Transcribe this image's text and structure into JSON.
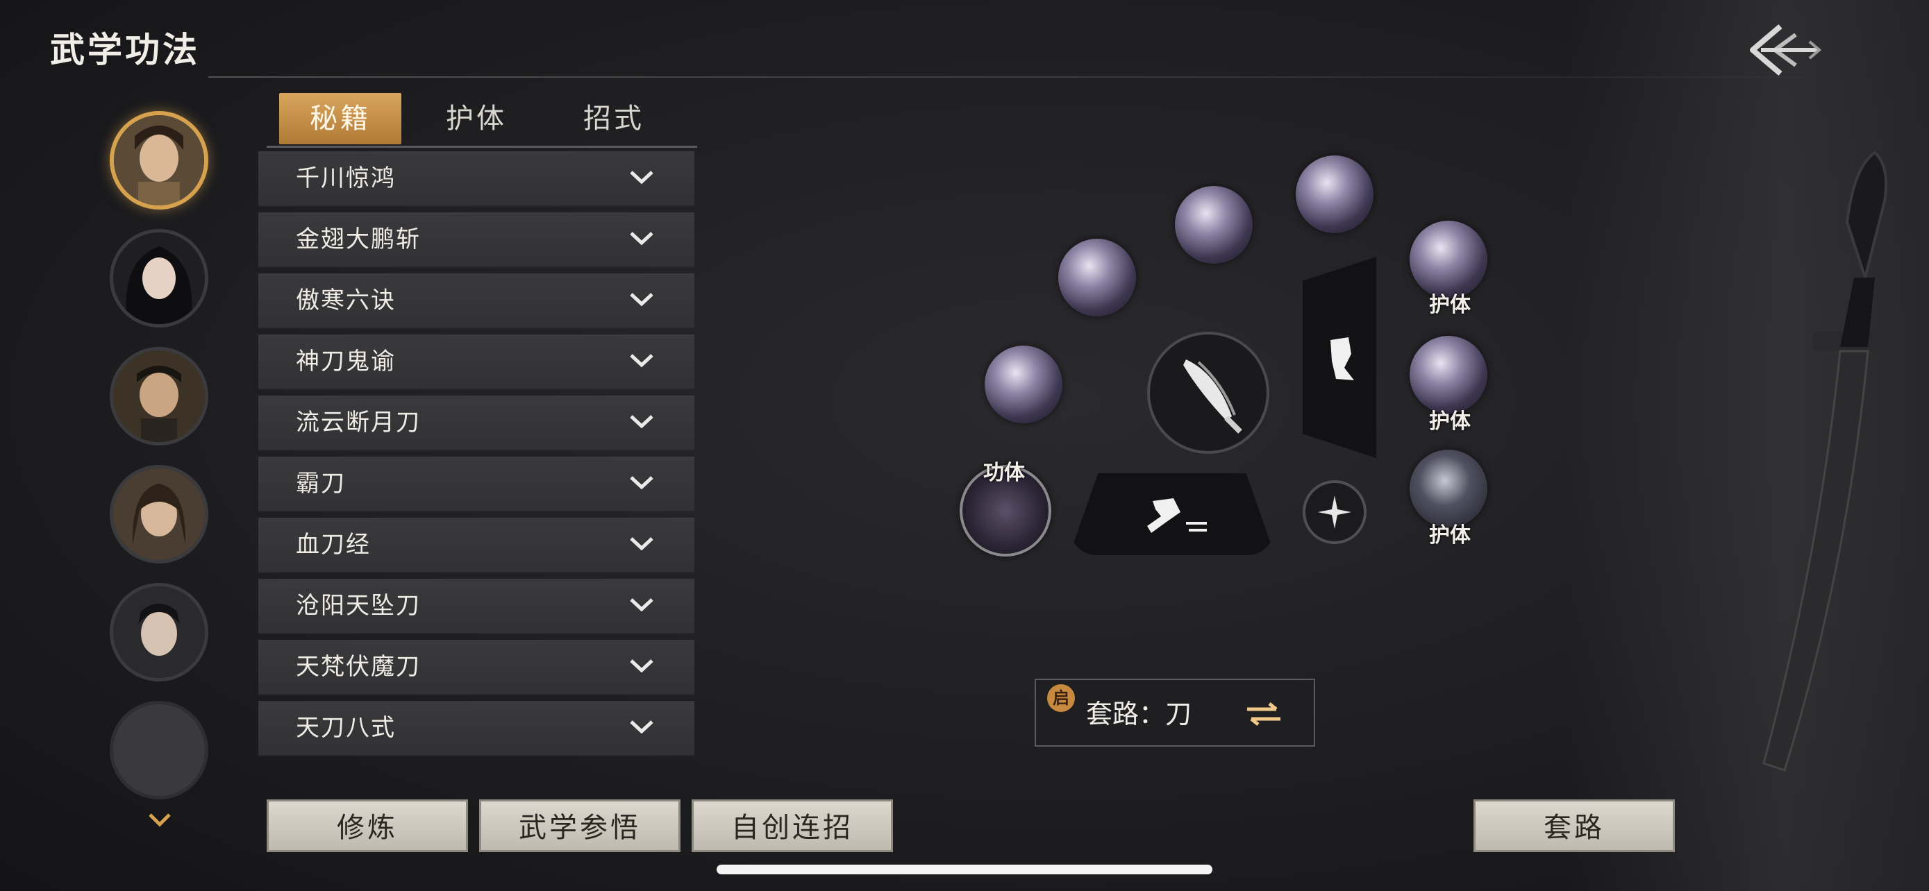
{
  "header": {
    "title": "武学功法"
  },
  "tabs": [
    {
      "label": "秘籍",
      "active": true
    },
    {
      "label": "护体",
      "active": false
    },
    {
      "label": "招式",
      "active": false
    }
  ],
  "skills": [
    {
      "label": "千川惊鸿"
    },
    {
      "label": "金翅大鹏斩"
    },
    {
      "label": "傲寒六诀"
    },
    {
      "label": "神刀鬼谕"
    },
    {
      "label": "流云断月刀"
    },
    {
      "label": "霸刀"
    },
    {
      "label": "血刀经"
    },
    {
      "label": "沧阳天坠刀"
    },
    {
      "label": "天梵伏魔刀"
    },
    {
      "label": "天刀八式"
    }
  ],
  "wheel": {
    "tags": {
      "gongti": "功体",
      "huti1": "护体",
      "huti2": "护体",
      "huti3": "护体"
    }
  },
  "routine": {
    "badge": "启",
    "text": "套路：刀"
  },
  "buttons": {
    "cultivate": "修炼",
    "comprehend": "武学参悟",
    "custom_combo": "自创连招",
    "routine": "套路"
  },
  "colors": {
    "accent": "#d7a24e",
    "tab_active": "#c48d45",
    "background": "#1d1d20"
  }
}
